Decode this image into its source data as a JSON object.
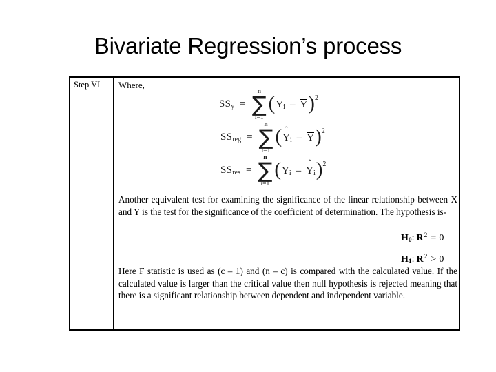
{
  "slide": {
    "title": "Bivariate Regression’s process"
  },
  "table": {
    "step_label": "Step VI",
    "where_label": "Where,",
    "equations": [
      {
        "name": "ss-total",
        "lhs": "SS",
        "lhs_sub": "y",
        "equals": "=",
        "sigma_upper": "n",
        "sigma_lower": "i=1",
        "sigma_glyph": "∑",
        "open_paren": "(",
        "term1": "Y",
        "term1_sub": "i",
        "term1_hat": false,
        "term1_bar": false,
        "operator": "–",
        "term2": "Y",
        "term2_sub": "",
        "term2_hat": false,
        "term2_bar": true,
        "close_paren": ")",
        "exponent": "2"
      },
      {
        "name": "ss-regression",
        "lhs": "SS",
        "lhs_sub": "reg",
        "equals": "=",
        "sigma_upper": "n",
        "sigma_lower": "i=1",
        "sigma_glyph": "∑",
        "open_paren": "(",
        "term1": "Y",
        "term1_sub": "i",
        "term1_hat": true,
        "term1_bar": false,
        "operator": "–",
        "term2": "Y",
        "term2_sub": "",
        "term2_hat": false,
        "term2_bar": true,
        "close_paren": ")",
        "exponent": "2"
      },
      {
        "name": "ss-residual",
        "lhs": "SS",
        "lhs_sub": "res",
        "equals": "=",
        "sigma_upper": "n",
        "sigma_lower": "i=1",
        "sigma_glyph": "∑",
        "open_paren": "(",
        "term1": "Y",
        "term1_sub": "i",
        "term1_hat": false,
        "term1_bar": false,
        "operator": "–",
        "term2": "Y",
        "term2_sub": "i",
        "term2_hat": true,
        "term2_bar": false,
        "close_paren": ")",
        "exponent": "2"
      }
    ],
    "paragraph_1": "Another equivalent test for examining the significance of the linear relationship between X and Y is the test for the significance of the coefficient of determination. The hypothesis is-",
    "paragraph_2": "Here F statistic is used as (c – 1) and (n – c) is compared with the calculated value. If the calculated value is larger than the critical value then null hypothesis is rejected meaning that there is a significant relationship between dependent and independent variable.",
    "hypotheses": [
      {
        "name": "null-hypothesis",
        "symbol": "H",
        "subscript": "0",
        "colon": ":",
        "variable": "R",
        "power": "2",
        "operator": "=",
        "value": "0"
      },
      {
        "name": "alternative-hypothesis",
        "symbol": "H",
        "subscript": "1",
        "colon": ":",
        "variable": "R",
        "power": "2",
        "operator": ">",
        "value": "0"
      }
    ]
  }
}
